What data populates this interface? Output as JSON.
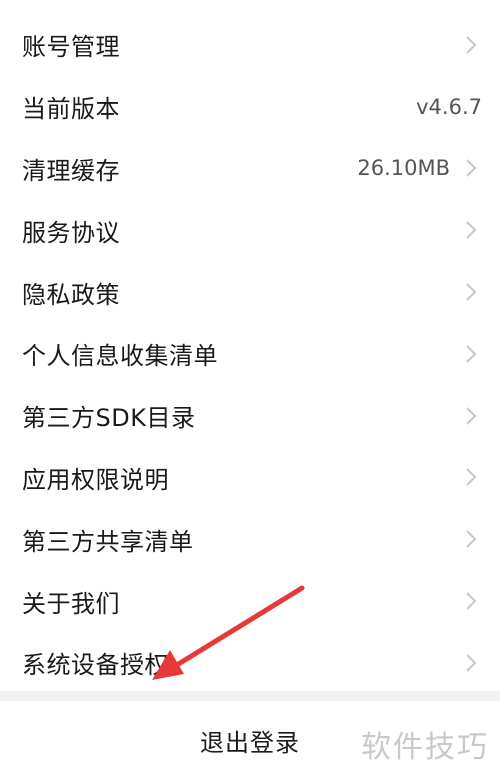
{
  "settings": {
    "items": [
      {
        "label": "账号管理",
        "value": "",
        "chevron": true
      },
      {
        "label": "当前版本",
        "value": "v4.6.7",
        "chevron": false
      },
      {
        "label": "清理缓存",
        "value": "26.10MB",
        "chevron": true
      },
      {
        "label": "服务协议",
        "value": "",
        "chevron": true
      },
      {
        "label": "隐私政策",
        "value": "",
        "chevron": true
      },
      {
        "label": "个人信息收集清单",
        "value": "",
        "chevron": true
      },
      {
        "label": "第三方SDK目录",
        "value": "",
        "chevron": true
      },
      {
        "label": "应用权限说明",
        "value": "",
        "chevron": true
      },
      {
        "label": "第三方共享清单",
        "value": "",
        "chevron": true
      },
      {
        "label": "关于我们",
        "value": "",
        "chevron": true
      },
      {
        "label": "系统设备授权",
        "value": "",
        "chevron": true
      }
    ]
  },
  "logout": {
    "label": "退出登录"
  },
  "watermark": {
    "text": "软件技巧"
  },
  "colors": {
    "arrow": "#e8393a",
    "chevron": "#c8c8c8",
    "divider": "#f2f2f2"
  }
}
